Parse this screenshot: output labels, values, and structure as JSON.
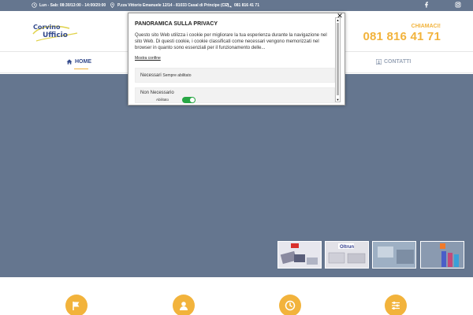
{
  "topbar": {
    "hours": "Lun - Sab: 08:30/13:00 - 14:00/20:00",
    "address": "P.zza Vittorio Emanuele 12/14 - 81033 Casal di Principe (CE)",
    "phone": "081 816 41 71",
    "social": [
      "facebook-icon",
      "instagram-icon"
    ]
  },
  "header": {
    "logo_line1": "Corvino",
    "logo_line2": "Ufficio",
    "call_label": "CHIAMACI!",
    "phone": "081 816 41 71"
  },
  "nav": {
    "home": "HOME",
    "contatti": "CONTATTI"
  },
  "slider": {
    "thumbs": [
      {
        "caption": "",
        "color": "#e7e7ee"
      },
      {
        "caption": "",
        "color": "#e2e2e8"
      },
      {
        "caption": "",
        "color": "#aab8c8"
      },
      {
        "caption": "",
        "color": "#7f8fa3"
      }
    ]
  },
  "features": {
    "icons": [
      "flag-icon",
      "user-icon",
      "clock-icon",
      "sliders-icon"
    ],
    "accent": "#f2b33c"
  },
  "privacy": {
    "title": "PANORAMICA SULLA PRIVACY",
    "text": "Questo sito Web utilizza i cookie per migliorare la tua esperienza durante la navigazione nel sito Web. Di questi cookie, i cookie classificati come necessari vengono memorizzati nel browser in quanto sono essenziali per il funzionamento delle...",
    "more": "Mostra confine",
    "categories": [
      {
        "name": "Necessari",
        "status": "Sempre abilitato"
      },
      {
        "name": "Non Necessario",
        "status": "Abilitato"
      }
    ],
    "close": "✕"
  },
  "colors": {
    "hero": "#65768f",
    "accent": "#f2b33c",
    "brand": "#344a8c"
  }
}
